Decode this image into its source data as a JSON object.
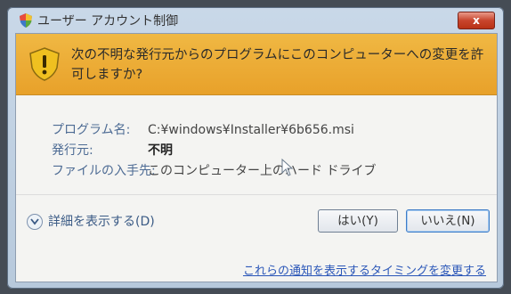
{
  "window": {
    "title": "ユーザー アカウント制御",
    "close_label": "x"
  },
  "banner": {
    "message": "次の不明な発行元からのプログラムにこのコンピューターへの変更を許可しますか?"
  },
  "details": {
    "program_label": "プログラム名:",
    "program_value": "C:¥windows¥Installer¥6b656.msi",
    "publisher_label": "発行元:",
    "publisher_value": "不明",
    "source_label": "ファイルの入手先:",
    "source_value": "このコンピューター上のハード ドライブ"
  },
  "footer": {
    "show_details_label": "詳細を表示する(D)",
    "yes_label": "はい(Y)",
    "no_label": "いいえ(N)",
    "notification_link": "これらの通知を表示するタイミングを変更する"
  },
  "colors": {
    "banner": "#e8a12a",
    "close_button": "#c8452d",
    "link": "#2a56b8"
  }
}
